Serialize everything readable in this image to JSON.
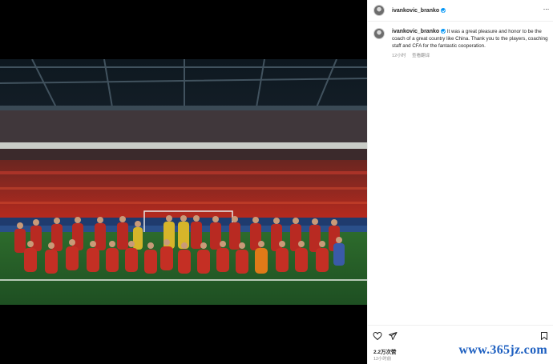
{
  "post": {
    "username": "ivankovic_branko",
    "more_label": "···",
    "caption_user": "ivankovic_branko",
    "caption_text": "It was a great pleasure and honor to be the coach of a great country like China. Thank you to the players, coaching staff and CFA for the fantastic cooperation.",
    "caption_time": "12小时",
    "translate_label": "查看翻译",
    "likes": "2.2万次赞",
    "time": "12小时前"
  },
  "icons": {
    "avatar": "profile-avatar",
    "verified": "verified-badge-icon",
    "more": "more-options-icon",
    "like": "heart-icon",
    "share": "share-icon",
    "save": "bookmark-icon"
  },
  "colors": {
    "verified": "#0095f6",
    "muted_text": "#8e8e8e",
    "watermark": "#1d5fc0",
    "media_background": "#000000"
  },
  "watermark": "www.365jz.com"
}
